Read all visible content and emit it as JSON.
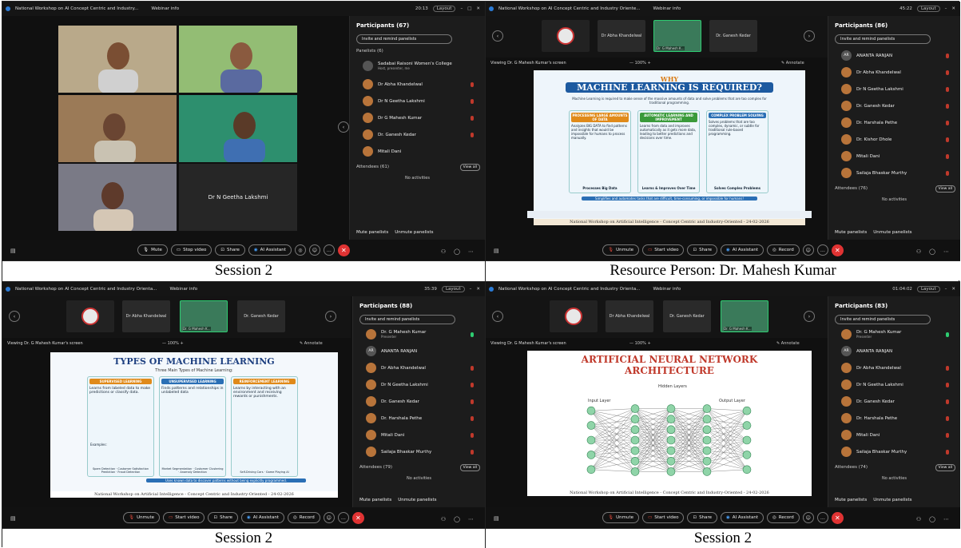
{
  "captions": {
    "q1": "Session 2",
    "q2": "Resource Person: Dr. Mahesh Kumar",
    "q3": "Session 2",
    "q4": "Session 2"
  },
  "window_title_short": "National Workshop on AI Concept Centric and Industry...",
  "window_title_long": "National Workshop on AI Concept Centric and Industry Oriente...",
  "window_title_mid": "National Workshop on AI Concept Centric and Industry Orienta...",
  "webinar_info": "Webinar info",
  "layout_label": "Layout",
  "q1": {
    "time": "20:13",
    "participants_title": "Participants (67)",
    "invite": "Invite and remind panelists",
    "panelists_header": "Panelists (6)",
    "host_name": "Sadabai Raisoni Women's College",
    "host_role": "Host, presenter, me",
    "panelists": [
      "Dr Abha Khandelwal",
      "Dr N Geetha Lakshmi",
      "Dr G Mahesh Kumar",
      "Dr. Ganesh Kedar",
      "Mitali Dani"
    ],
    "attendees_header": "Attendees (61)",
    "view_all": "View all",
    "no_activities": "No activities",
    "mute_panelists": "Mute panelists",
    "unmute_panelists": "Unmute panelists",
    "tile_name": "Dr N Geetha Lakshmi",
    "controls": [
      "Mute",
      "Stop video",
      "Share",
      "AI Assistant"
    ]
  },
  "q2": {
    "time": "45:22",
    "participants_title": "Participants (86)",
    "invite": "Invite and remind panelists",
    "strip_names": [
      "Dr Abha Khandelwal",
      "Dr. G Mahesh K...",
      "Dr. Ganesh Kedar"
    ],
    "viewing": "Viewing Dr. G Mahesh Kumar's screen",
    "zoom": "100%",
    "annotate": "Annotate",
    "participants": [
      "ANANTA RANJAN",
      "Dr Abha Khandelwal",
      "Dr N Geetha Lakshmi",
      "Dr. Ganesh Kedar",
      "Dr. Harshala Pethe",
      "Dr. Kishor Dhole",
      "Mitali Dani",
      "Sailaja Bhaskar Murthy"
    ],
    "avatar_initials": "AR",
    "attendees_header": "Attendees (76)",
    "view_all": "View all",
    "no_activities": "No activities",
    "mute_panelists": "Mute panelists",
    "unmute_panelists": "Unmute panelists",
    "slide_why": "WHY",
    "slide_title": "MACHINE LEARNING IS REQUIRED?",
    "slide_intro": "Machine Learning is required to make sense of the massive amounts of data and solve problems that are too complex for traditional programming.",
    "cols": [
      {
        "head": "PROCESSING LARGE AMOUNTS OF DATA",
        "body": "Analyzes BIG DATA to find patterns and insights that would be impossible for humans to process manually.",
        "foot": "Processes Big Data"
      },
      {
        "head": "AUTOMATIC LEARNING AND IMPROVEMENT",
        "body": "Learns from data and improves automatically as it gets more data, leading to better predictions and decisions over time.",
        "foot": "Learns & Improves Over Time"
      },
      {
        "head": "COMPLEX PROBLEM SOLVING",
        "body": "Solves problems that are too complex, dynamic, or subtle for traditional rule-based programming.",
        "foot": "Solves Complex Problems"
      }
    ],
    "slide_bottom": "Simplifies and automates tasks that are difficult, time-consuming, or impossible for humans!",
    "slide_footer": "National Workshop on Artificial Intelligence - Concept Centric and Industry-Oriented - 24-02-2026",
    "controls": [
      "Unmute",
      "Start video",
      "Share",
      "AI Assistant",
      "Record"
    ]
  },
  "q3": {
    "time": "35:39",
    "participants_title": "Participants (88)",
    "invite": "Invite and remind panelists",
    "strip_names": [
      "Dr Abha Khandelwal",
      "Dr. G Mahesh K...",
      "Dr. Ganesh Kedar"
    ],
    "viewing": "Viewing Dr. G Mahesh Kumar's screen",
    "zoom": "100%",
    "annotate": "Annotate",
    "presenter_name": "Dr. G Mahesh Kumar",
    "presenter_role": "Presenter",
    "participants": [
      "ANANTA RANJAN",
      "Dr Abha Khandelwal",
      "Dr N Geetha Lakshmi",
      "Dr. Ganesh Kedar",
      "Dr. Harshala Pethe",
      "Mitali Dani",
      "Sailaja Bhaskar Murthy"
    ],
    "avatar_initials": "AR",
    "attendees_header": "Attendees (79)",
    "view_all": "View all",
    "no_activities": "No activities",
    "mute_panelists": "Mute panelists",
    "unmute_panelists": "Unmute panelists",
    "slide_title": "TYPES OF MACHINE LEARNING",
    "slide_sub": "Three Main Types of Machine Learning:",
    "cols": [
      {
        "head": "SUPERVISED LEARNING",
        "body": "Learns from labeled data to make predictions or classify data.",
        "ex": "Spam Detection · Customer Satisfaction Prediction · Fraud Detection"
      },
      {
        "head": "UNSUPERVISED LEARNING",
        "body": "Finds patterns and relationships in unlabeled data",
        "ex": "Market Segmentation · Customer Clustering · Anomaly Detection"
      },
      {
        "head": "REINFORCEMENT LEARNING",
        "body": "Learns by interacting with an environment and receiving rewards or punishments.",
        "ex": "Self-Driving Cars · Game Playing AI"
      }
    ],
    "examples_label": "Examples:",
    "slide_bottom": "Uses known data to discover patterns without being explicitly programmed.",
    "slide_footer": "National Workshop on Artificial Intelligence - Concept Centric and Industry-Oriented - 24-02-2026",
    "controls": [
      "Unmute",
      "Start video",
      "Share",
      "AI Assistant",
      "Record"
    ]
  },
  "q4": {
    "time": "01:04:02",
    "participants_title": "Participants (83)",
    "invite": "Invite and remind panelists",
    "strip_names": [
      "Dr Abha Khandelwal",
      "Dr. Ganesh Kedar",
      "Dr. G Mahesh K..."
    ],
    "viewing": "Viewing Dr. G Mahesh Kumar's screen",
    "zoom": "100%",
    "annotate": "Annotate",
    "presenter_name": "Dr. G Mahesh Kumar",
    "presenter_role": "Presenter",
    "participants": [
      "ANANTA RANJAN",
      "Dr Abha Khandelwal",
      "Dr N Geetha Lakshmi",
      "Dr. Ganesh Kedar",
      "Dr. Harshala Pethe",
      "Mitali Dani",
      "Sailaja Bhaskar Murthy"
    ],
    "avatar_initials": "AR",
    "attendees_header": "Attendees (74)",
    "view_all": "View all",
    "no_activities": "No activities",
    "mute_panelists": "Mute panelists",
    "unmute_panelists": "Unmute panelists",
    "slide_title_1": "ARTIFICIAL NEURAL NETWORK",
    "slide_title_2": "ARCHITECTURE",
    "hidden_layers": "Hidden Layers",
    "input_layer": "Input Layer",
    "output_layer": "Output Layer",
    "slide_footer": "National Workshop on Artificial Intelligence - Concept Centric and Industry-Oriented - 24-02-2026",
    "controls": [
      "Unmute",
      "Start video",
      "Share",
      "AI Assistant",
      "Record"
    ]
  },
  "colors": {
    "accent": "#2b7bd6",
    "end_call": "#e03333",
    "avatar": "#b8743a"
  }
}
